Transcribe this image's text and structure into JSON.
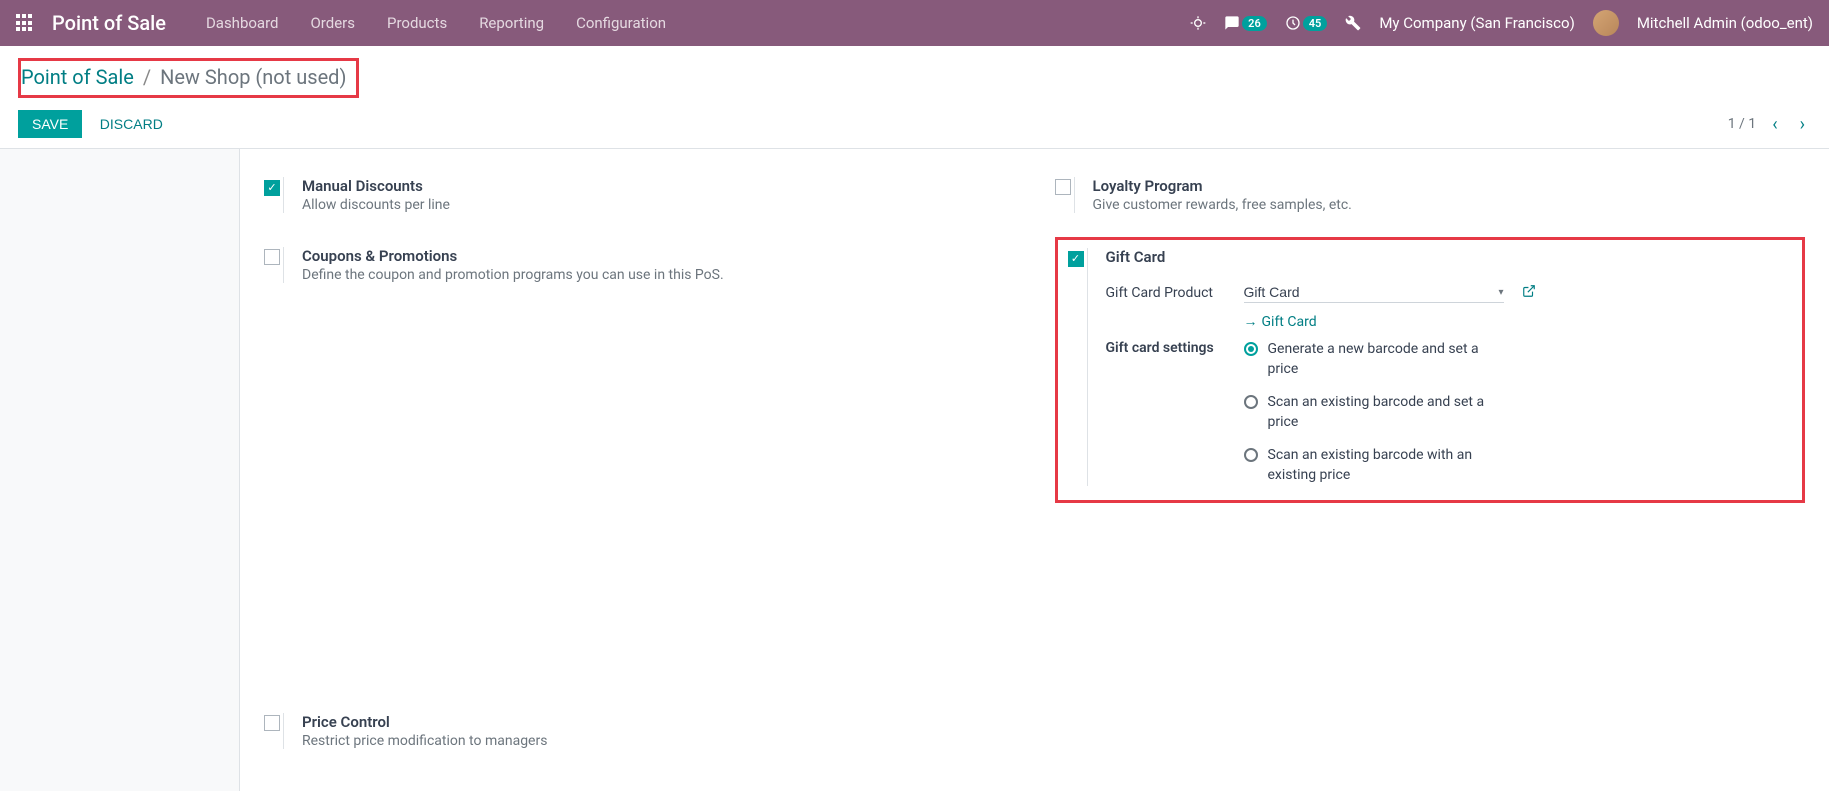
{
  "topbar": {
    "app_title": "Point of Sale",
    "menu": [
      "Dashboard",
      "Orders",
      "Products",
      "Reporting",
      "Configuration"
    ],
    "messages_badge": "26",
    "activities_badge": "45",
    "company": "My Company (San Francisco)",
    "user": "Mitchell Admin (odoo_ent)"
  },
  "breadcrumb": {
    "root": "Point of Sale",
    "current": "New Shop (not used)"
  },
  "actions": {
    "save": "SAVE",
    "discard": "DISCARD",
    "pager": "1 / 1"
  },
  "settings": {
    "manual_discounts": {
      "title": "Manual Discounts",
      "desc": "Allow discounts per line",
      "checked": true
    },
    "loyalty": {
      "title": "Loyalty Program",
      "desc": "Give customer rewards, free samples, etc.",
      "checked": false
    },
    "coupons": {
      "title": "Coupons & Promotions",
      "desc": "Define the coupon and promotion programs you can use in this PoS.",
      "checked": false
    },
    "gift_card": {
      "title": "Gift Card",
      "checked": true,
      "product_label": "Gift Card Product",
      "product_value": "Gift Card",
      "link_text": "Gift Card",
      "settings_label": "Gift card settings",
      "options": [
        "Generate a new barcode and set a price",
        "Scan an existing barcode and set a price",
        "Scan an existing barcode with an existing price"
      ],
      "selected": 0
    },
    "price_control": {
      "title": "Price Control",
      "desc": "Restrict price modification to managers",
      "checked": false
    }
  }
}
